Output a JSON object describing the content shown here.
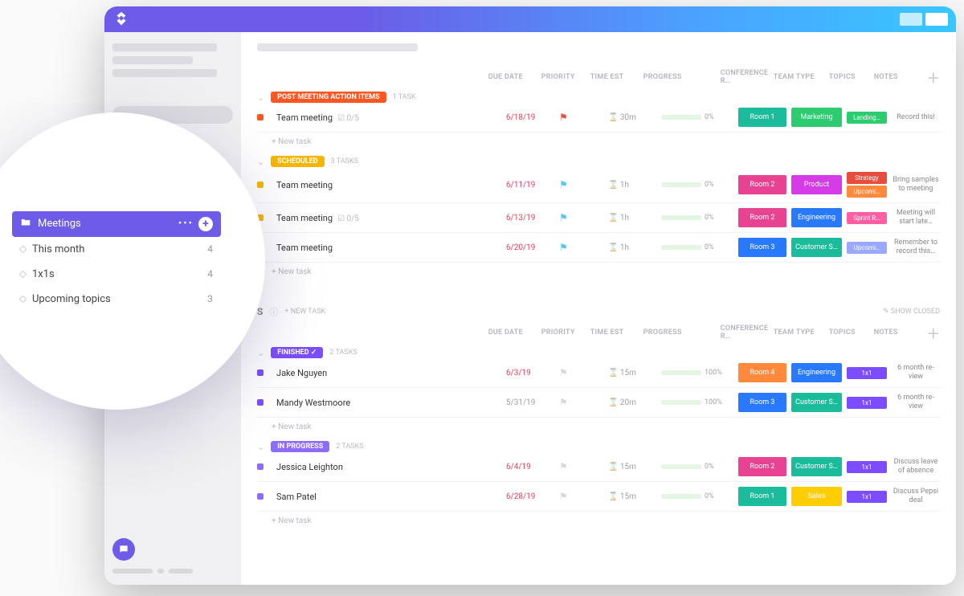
{
  "folder": {
    "name": "Meetings",
    "lists": [
      {
        "name": "This month",
        "count": 4
      },
      {
        "name": "1x1s",
        "count": 4
      },
      {
        "name": "Upcoming topics",
        "count": 3
      }
    ]
  },
  "columns": [
    "DUE DATE",
    "PRIORITY",
    "TIME EST",
    "PROGRESS",
    "CONFERENCE R…",
    "TEAM TYPE",
    "TOPICS",
    "NOTES"
  ],
  "new_task_label": "+ New task",
  "new_task_upper": "+ NEW TASK",
  "show_closed": "SHOW CLOSED",
  "groups1": [
    {
      "status": "POST MEETING ACTION ITEMS",
      "status_color": "#ff5722",
      "count_label": "1 TASK",
      "tasks": [
        {
          "sq": "#ff5722",
          "title": "Team meeting",
          "sub": "☑ 0/5",
          "date": "6/18/19",
          "date_grey": false,
          "flag_color": "#e74c3c",
          "time": "30m",
          "progress": 0,
          "room": {
            "text": "Room 1",
            "color": "#1abc9c"
          },
          "team": {
            "text": "Marketing",
            "color": "#2ecc71"
          },
          "topics": [
            {
              "text": "Landing…",
              "color": "#2ecc71"
            }
          ],
          "note": "Record this!"
        }
      ]
    },
    {
      "status": "SCHEDULED",
      "status_color": "#f8b500",
      "count_label": "3 TASKS",
      "tasks": [
        {
          "sq": "#f8b500",
          "title": "Team meeting",
          "sub": "",
          "date": "6/11/19",
          "date_grey": false,
          "flag_color": "#58c5f0",
          "time": "1h",
          "progress": 0,
          "room": {
            "text": "Room 2",
            "color": "#e84393"
          },
          "team": {
            "text": "Product",
            "color": "#d63be8"
          },
          "topics": [
            {
              "text": "Strategy",
              "color": "#e74c3c"
            },
            {
              "text": "Upcomi…",
              "color": "#ff8a3d"
            }
          ],
          "note": "Bring samples to meeting"
        },
        {
          "sq": "#f8b500",
          "title": "Team meeting",
          "sub": "☑ 0/5",
          "date": "6/13/19",
          "date_grey": false,
          "flag_color": "#58c5f0",
          "time": "1h",
          "progress": 0,
          "room": {
            "text": "Room 2",
            "color": "#e84393"
          },
          "team": {
            "text": "Engineering",
            "color": "#2979ff"
          },
          "topics": [
            {
              "text": "Sprint R…",
              "color": "#ff5fa2"
            }
          ],
          "note": "Meeting will start late…"
        },
        {
          "sq": "#f8b500",
          "title": "Team meeting",
          "sub": "",
          "date": "6/20/19",
          "date_grey": false,
          "flag_color": "#58c5f0",
          "time": "1h",
          "progress": 0,
          "room": {
            "text": "Room 3",
            "color": "#2979ff"
          },
          "team": {
            "text": "Customer S…",
            "color": "#1abc9c"
          },
          "topics": [
            {
              "text": "Upcomi…",
              "color": "#9aa9ff"
            }
          ],
          "note": "Remember to record this…"
        }
      ]
    }
  ],
  "groups2": [
    {
      "status": "FINISHED",
      "status_color": "#7c4dff",
      "status_icon": "✓",
      "count_label": "2 TASKS",
      "tasks": [
        {
          "sq": "#7c4dff",
          "title": "Jake Nguyen",
          "sub": "",
          "date": "6/3/19",
          "date_grey": false,
          "flag_color": "#d8d8dc",
          "time": "15m",
          "progress": 100,
          "room": {
            "text": "Room 4",
            "color": "#ff8a3d"
          },
          "team": {
            "text": "Engineering",
            "color": "#2979ff"
          },
          "topics": [
            {
              "text": "1x1",
              "color": "#7c4dff"
            }
          ],
          "note": "6 month re-view"
        },
        {
          "sq": "#7c4dff",
          "title": "Mandy Westmoore",
          "sub": "",
          "date": "5/31/19",
          "date_grey": true,
          "flag_color": "#d8d8dc",
          "time": "20m",
          "progress": 100,
          "room": {
            "text": "Room 3",
            "color": "#2979ff"
          },
          "team": {
            "text": "Customer S…",
            "color": "#1abc9c"
          },
          "topics": [
            {
              "text": "1x1",
              "color": "#7c4dff"
            }
          ],
          "note": "6 month re-view"
        }
      ]
    },
    {
      "status": "IN PROGRESS",
      "status_color": "#8e6cff",
      "count_label": "2 TASKS",
      "tasks": [
        {
          "sq": "#8e6cff",
          "title": "Jessica Leighton",
          "sub": "",
          "date": "6/4/19",
          "date_grey": false,
          "flag_color": "#d8d8dc",
          "time": "15m",
          "progress": 0,
          "room": {
            "text": "Room 2",
            "color": "#e84393"
          },
          "team": {
            "text": "Customer S…",
            "color": "#1abc9c"
          },
          "topics": [
            {
              "text": "1x1",
              "color": "#7c4dff"
            }
          ],
          "note": "Discuss leave of absence"
        },
        {
          "sq": "#8e6cff",
          "title": "Sam Patel",
          "sub": "",
          "date": "6/28/19",
          "date_grey": false,
          "flag_color": "#d8d8dc",
          "time": "15m",
          "progress": 0,
          "room": {
            "text": "Room 1",
            "color": "#1abc9c"
          },
          "team": {
            "text": "Sales",
            "color": "#ffcd00"
          },
          "topics": [
            {
              "text": "1x1",
              "color": "#7c4dff"
            }
          ],
          "note": "Discuss Pepsi deal"
        }
      ]
    }
  ]
}
